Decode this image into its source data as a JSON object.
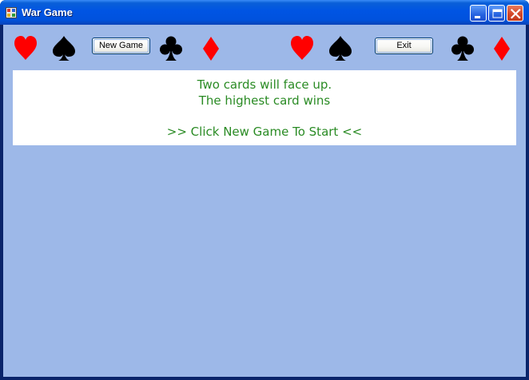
{
  "window": {
    "title": "War Game"
  },
  "toolbar": {
    "new_game_label": "New Game",
    "exit_label": "Exit",
    "suits_left": [
      "heart-icon",
      "spade-icon",
      "club-icon",
      "diamond-icon"
    ],
    "suits_right": [
      "heart-icon",
      "spade-icon",
      "club-icon",
      "diamond-icon"
    ]
  },
  "message": {
    "line1": "Two cards will face up.",
    "line2": "The highest card wins",
    "line3": ">> Click New Game To Start <<"
  },
  "colors": {
    "client_background": "#9db8e8",
    "message_text": "#2a8b24",
    "red_suit": "#ff0000",
    "black_suit": "#000000"
  }
}
